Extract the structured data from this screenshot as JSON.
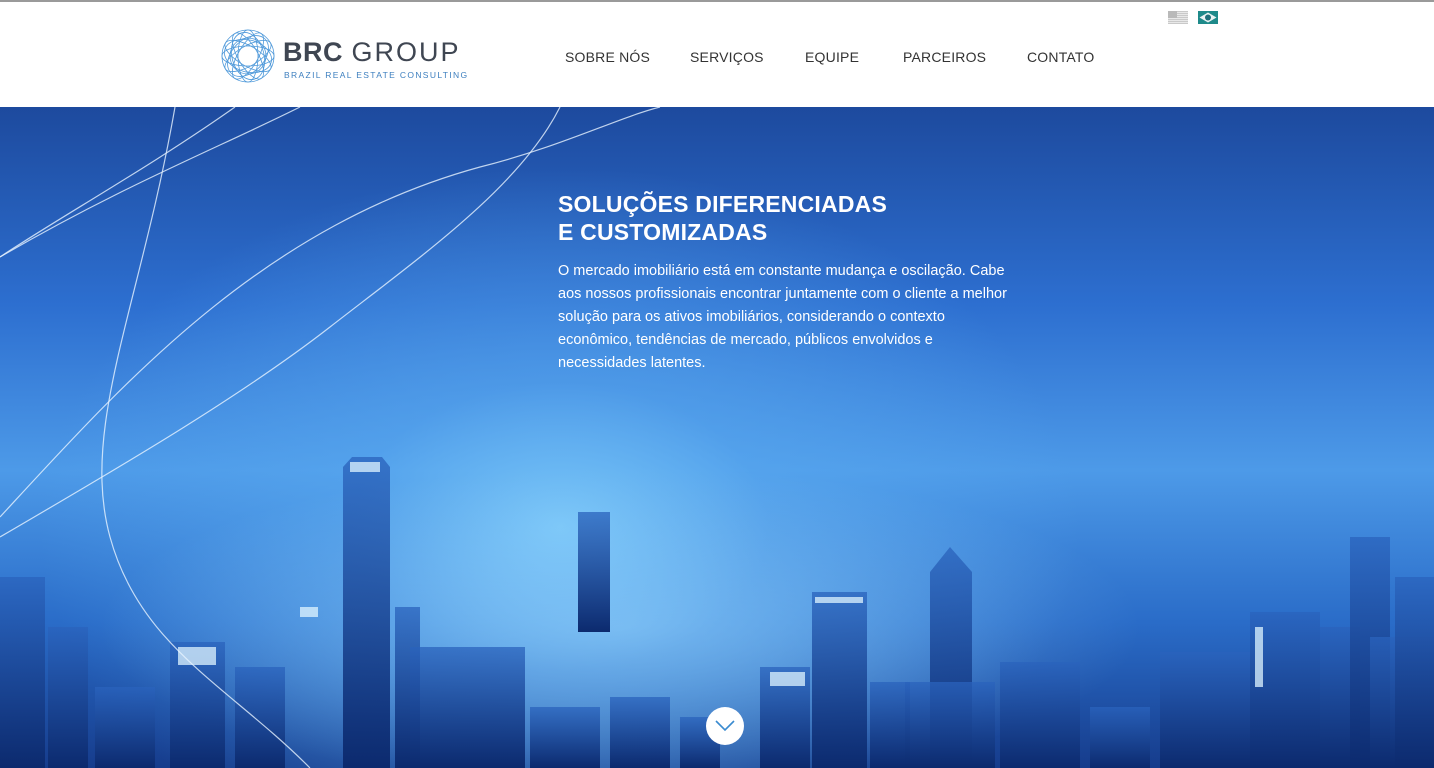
{
  "brand": {
    "name_bold": "BRC",
    "name_thin": "GROUP",
    "tagline": "BRAZIL REAL ESTATE CONSULTING",
    "logo_icon": "spirograph-globe-icon",
    "color": "#3d7fbf"
  },
  "nav": {
    "items": [
      {
        "label": "SOBRE NÓS"
      },
      {
        "label": "SERVIÇOS"
      },
      {
        "label": "EQUIPE"
      },
      {
        "label": "PARCEIROS"
      },
      {
        "label": "CONTATO"
      }
    ]
  },
  "languages": [
    {
      "icon": "us-flag-icon"
    },
    {
      "icon": "brazil-flag-icon"
    }
  ],
  "hero": {
    "title_line1": "SOLUÇÕES DIFERENCIADAS",
    "title_line2": "E CUSTOMIZADAS",
    "text": "O mercado imobiliário está em constante mudança e oscilação. Cabe aos nossos profissionais encontrar juntamente com o cliente a melhor solução para os ativos imobiliários, considerando o contexto econômico, tendências de mercado, públicos envolvidos e necessidades latentes.",
    "background": "city-skyline-night-blue",
    "scroll_icon": "chevron-down-icon"
  },
  "colors": {
    "hero_dark": "#163c8c",
    "hero_light": "#77c4f7",
    "nav_text": "#333333"
  }
}
